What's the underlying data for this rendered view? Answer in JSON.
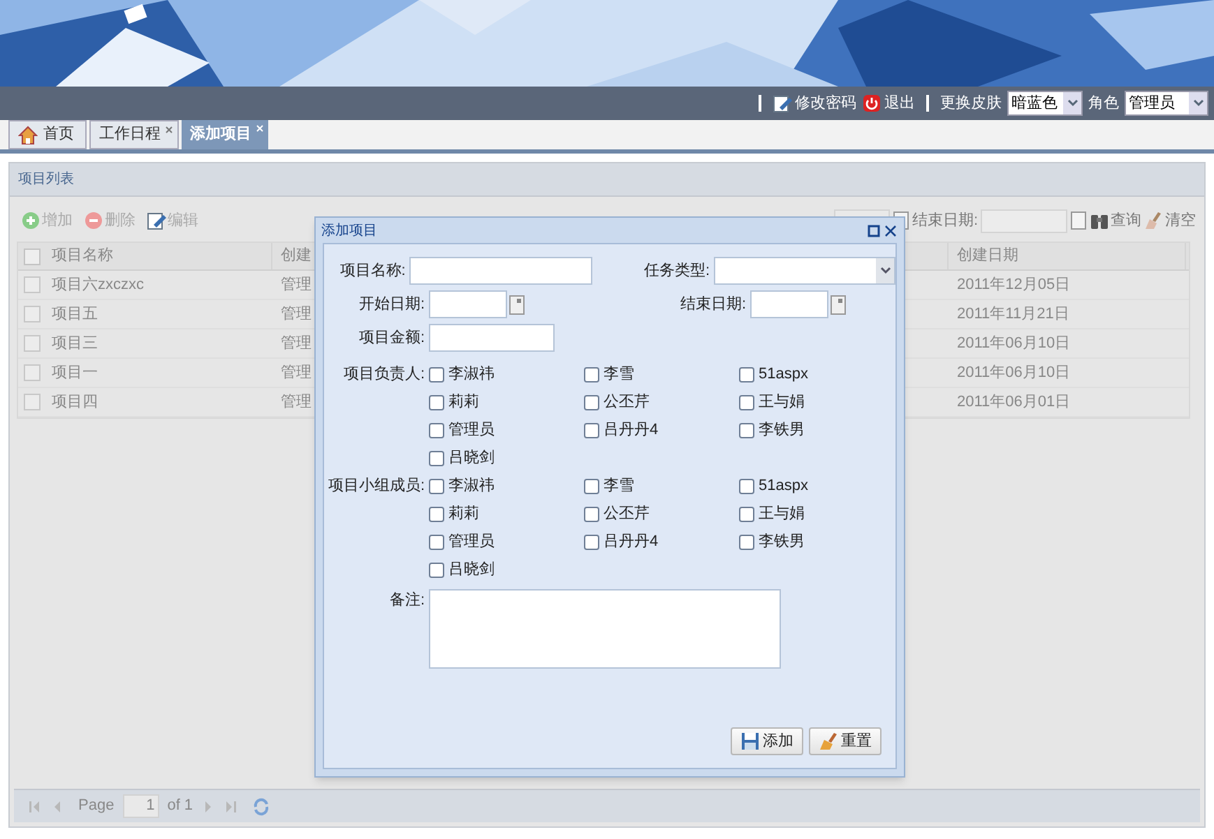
{
  "top_bar": {
    "links": [
      {
        "kind": "edit",
        "label": "修改密码"
      },
      {
        "kind": "logout",
        "label": "退出"
      }
    ],
    "skin_label": "更换皮肤",
    "skin_value": "暗蓝色",
    "role_label": "角色",
    "role_value": "管理员"
  },
  "tabs": [
    {
      "kind": "home",
      "label": "首页",
      "selected": false,
      "closable": false
    },
    {
      "kind": "page",
      "label": "工作日程",
      "selected": false,
      "closable": true
    },
    {
      "kind": "page",
      "label": "添加项目",
      "selected": true,
      "closable": true
    }
  ],
  "panel": {
    "title": "项目列表",
    "toolbar": [
      {
        "kind": "add",
        "label": "增加"
      },
      {
        "kind": "delete",
        "label": "删除"
      },
      {
        "kind": "edit",
        "label": "编辑"
      }
    ],
    "search": {
      "end_date_label": "结束日期:",
      "buttons": [
        {
          "kind": "search",
          "label": "查询"
        },
        {
          "kind": "clear",
          "label": "清空"
        }
      ]
    },
    "table": {
      "select_all_checked": false,
      "columns": [
        "项目名称",
        "创建",
        "创建日期"
      ],
      "rows": [
        {
          "checked": false,
          "name": "项目六zxczxc",
          "creator": "管理",
          "date": "2011年12月05日"
        },
        {
          "checked": false,
          "name": "项目五",
          "creator": "管理",
          "date": "2011年11月21日"
        },
        {
          "checked": false,
          "name": "项目三",
          "creator": "管理",
          "date": "2011年06月10日"
        },
        {
          "checked": false,
          "name": "项目一",
          "creator": "管理",
          "date": "2011年06月10日"
        },
        {
          "checked": false,
          "name": "项目四",
          "creator": "管理",
          "date": "2011年06月01日"
        }
      ]
    },
    "pager": {
      "page_label": "Page",
      "page_value": "1",
      "of_label": "of 1"
    }
  },
  "dialog": {
    "title": "添加项目",
    "rows": [
      [
        {
          "kind": "text",
          "label": "项目名称:"
        },
        {
          "kind": "select",
          "label": "任务类型:"
        }
      ],
      [
        {
          "kind": "date",
          "label": "开始日期:"
        },
        {
          "kind": "date",
          "label": "结束日期:"
        }
      ],
      [
        {
          "kind": "amount",
          "label": "项目金额:"
        }
      ]
    ],
    "groups": [
      {
        "label": "项目负责人:",
        "options": [
          {
            "label": "李淑祎",
            "checked": false
          },
          {
            "label": "李雪",
            "checked": false
          },
          {
            "label": "51aspx",
            "checked": false
          },
          {
            "label": "莉莉",
            "checked": false
          },
          {
            "label": "公丕芹",
            "checked": false
          },
          {
            "label": "王与娟",
            "checked": false
          },
          {
            "label": "管理员",
            "checked": false
          },
          {
            "label": "吕丹丹4",
            "checked": false
          },
          {
            "label": "李铁男",
            "checked": false
          },
          {
            "label": "吕晓剑",
            "checked": false
          }
        ]
      },
      {
        "label": "项目小组成员:",
        "options": [
          {
            "label": "李淑祎",
            "checked": false
          },
          {
            "label": "李雪",
            "checked": false
          },
          {
            "label": "51aspx",
            "checked": false
          },
          {
            "label": "莉莉",
            "checked": false
          },
          {
            "label": "公丕芹",
            "checked": false
          },
          {
            "label": "王与娟",
            "checked": false
          },
          {
            "label": "管理员",
            "checked": false
          },
          {
            "label": "吕丹丹4",
            "checked": false
          },
          {
            "label": "李铁男",
            "checked": false
          },
          {
            "label": "吕晓剑",
            "checked": false
          }
        ]
      }
    ],
    "remark_label": "备注:",
    "buttons": [
      {
        "kind": "save",
        "label": "添加"
      },
      {
        "kind": "reset",
        "label": "重置"
      }
    ]
  }
}
